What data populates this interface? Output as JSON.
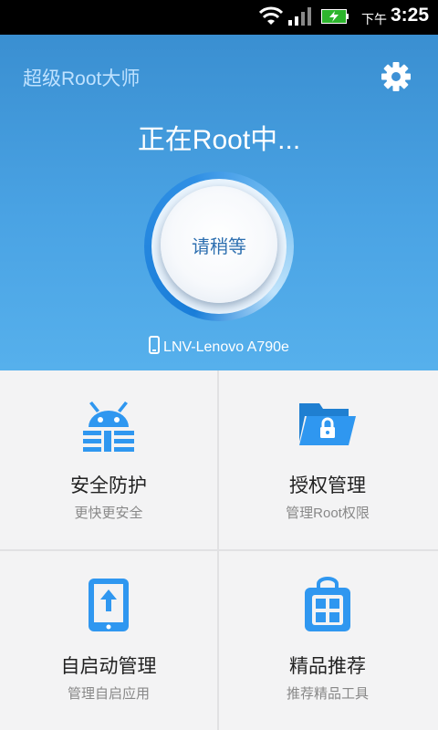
{
  "status_bar": {
    "ampm": "下午",
    "time": "3:25"
  },
  "header": {
    "app_title": "超级Root大师",
    "settings_icon": "gear-icon"
  },
  "root": {
    "status_text": "正在Root中...",
    "button_label": "请稍等"
  },
  "device": {
    "name": "LNV-Lenovo A790e",
    "icon": "phone-icon"
  },
  "tiles": [
    {
      "title": "安全防护",
      "subtitle": "更快更安全",
      "icon": "security-robot-icon"
    },
    {
      "title": "授权管理",
      "subtitle": "管理Root权限",
      "icon": "lock-folder-icon"
    },
    {
      "title": "自启动管理",
      "subtitle": "管理自启应用",
      "icon": "phone-upload-icon"
    },
    {
      "title": "精品推荐",
      "subtitle": "推荐精品工具",
      "icon": "app-store-bag-icon"
    }
  ],
  "colors": {
    "accent": "#3a96e0",
    "icon_blue": "#2f97f0"
  }
}
